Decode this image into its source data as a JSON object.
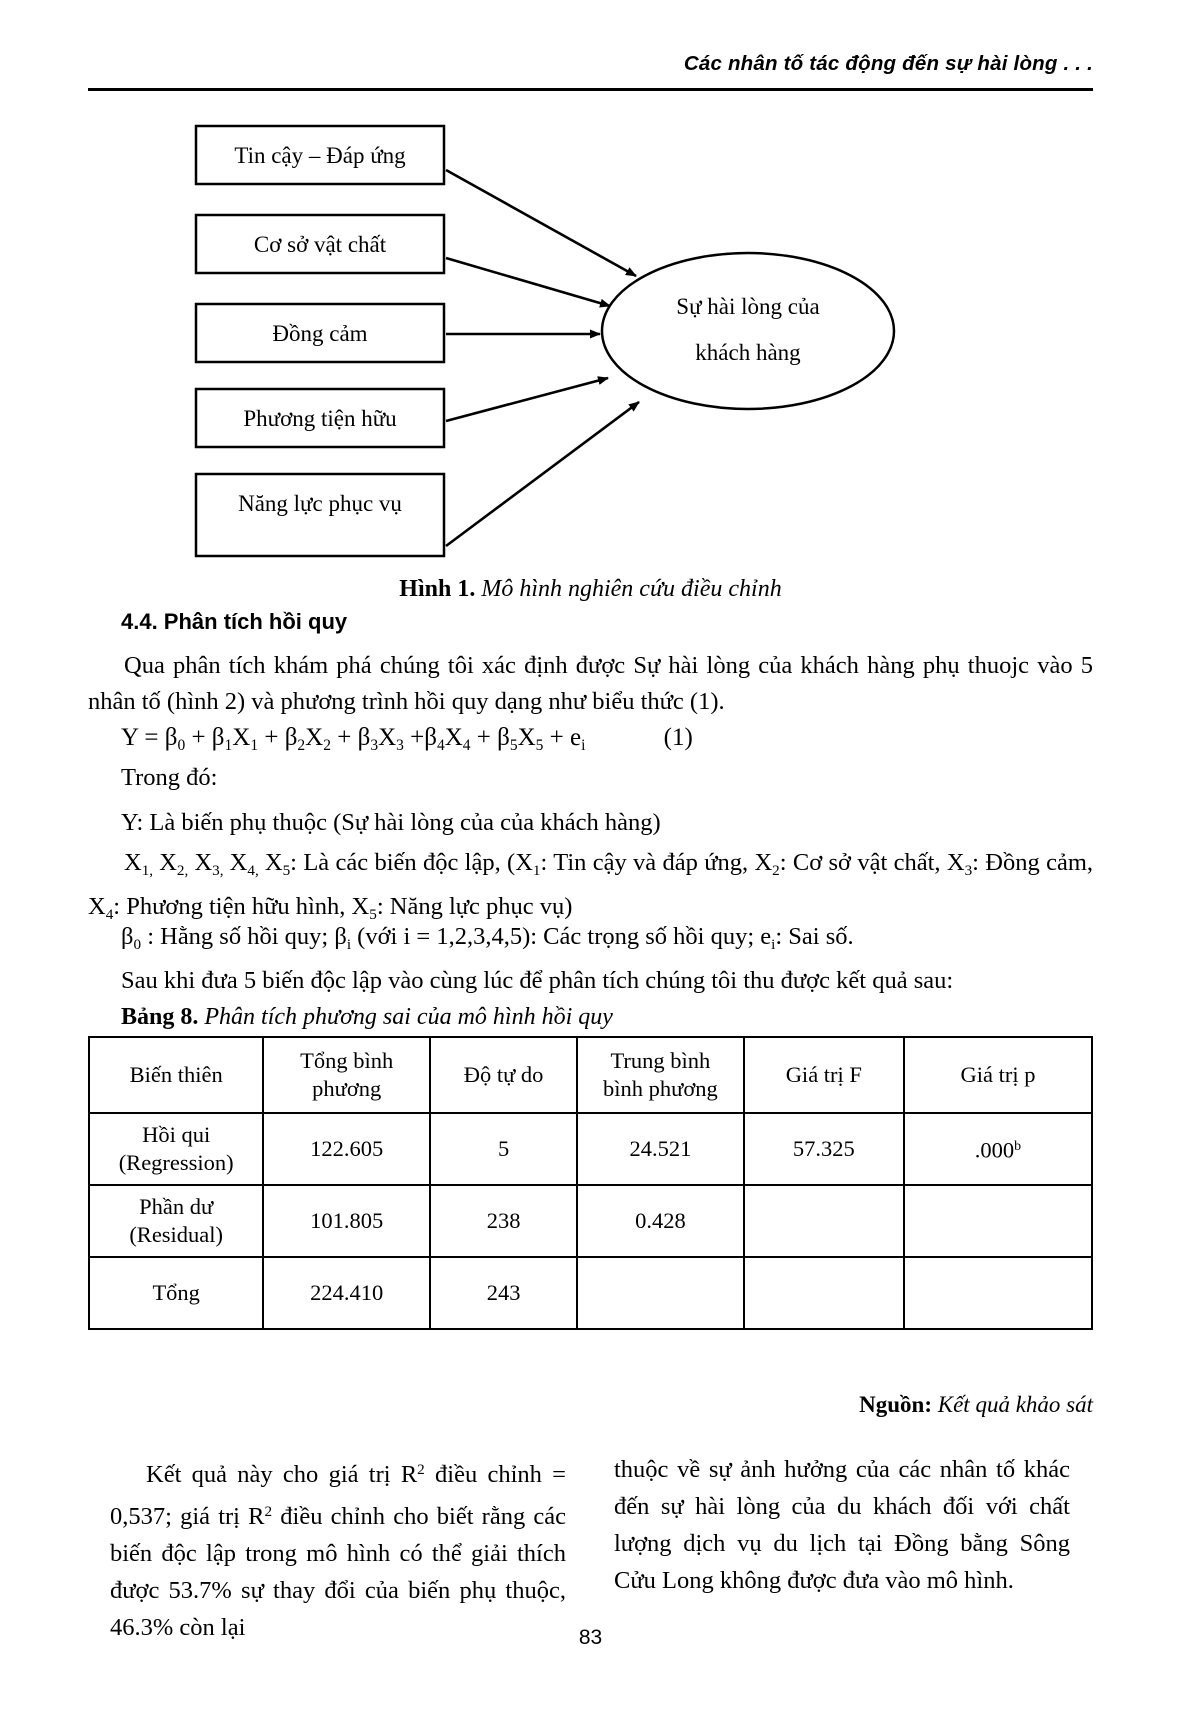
{
  "header": {
    "running_title": "Các nhân tố tác động đến sự hài lòng . . ."
  },
  "figure": {
    "boxes": [
      {
        "label": "Tin cậy – Đáp ứng"
      },
      {
        "label": "Cơ sở vật chất"
      },
      {
        "label": "Đồng cảm"
      },
      {
        "label": "Phương tiện hữu"
      },
      {
        "label": "Năng lực phục vụ"
      }
    ],
    "ellipse": {
      "line1": "Sự hài lòng của",
      "line2": "khách hàng"
    },
    "caption_label": "Hình 1.",
    "caption_text": "Mô hình nghiên cứu điều chỉnh"
  },
  "section": {
    "heading": "4.4. Phân tích hồi quy",
    "intro": "Qua phân tích khám phá chúng tôi xác định được Sự hài lòng của khách hàng phụ thuojc vào 5 nhân tố (hình 2) và phương trình hồi quy dạng như biểu thức (1).",
    "equation": {
      "lhs": "Y = β",
      "number": "(1)"
    },
    "trong_do": "Trong đó:",
    "y_def": "Y: Là biến phụ thuộc (Sự hài lòng của của khách hàng)",
    "x_def_tail": ": Là các biến độc lập, (X",
    "x_def_1": ": Tin cậy và đáp ứng, X",
    "x_def_2": ": Cơ sở vật chất, X",
    "x_def_3": ": Đồng cảm, X",
    "x_def_4": ": Phương tiện hữu hình, X",
    "x_def_5": ": Năng lực phục vụ)",
    "beta_def_a": " : Hằng số hồi quy; β",
    "beta_def_b": " (với i = 1,2,3,4,5): Các trọng số hồi quy; e",
    "beta_def_c": ": Sai số.",
    "sau_khi": "Sau khi đưa 5 biến độc lập vào cùng lúc để phân tích chúng tôi thu được kết quả sau:"
  },
  "table": {
    "title_label": "Bảng 8.",
    "title_text": "Phân tích phương sai của mô hình hồi quy",
    "columns": [
      "Biến thiên",
      "Tổng bình phương",
      "Độ tự do",
      "Trung bình bình phương",
      "Giá trị F",
      "Giá trị p"
    ],
    "rows": [
      {
        "name_line1": "Hồi qui",
        "name_line2": "(Regression)",
        "ss": "122.605",
        "df": "5",
        "ms": "24.521",
        "f": "57.325",
        "p": ".000",
        "p_sup": "b"
      },
      {
        "name_line1": "Phần dư",
        "name_line2": "(Residual)",
        "ss": "101.805",
        "df": "238",
        "ms": "0.428",
        "f": "",
        "p": "",
        "p_sup": ""
      },
      {
        "name_line1": "Tổng",
        "name_line2": "",
        "ss": "224.410",
        "df": "243",
        "ms": "",
        "f": "",
        "p": "",
        "p_sup": ""
      }
    ],
    "source_label": "Nguồn:",
    "source_text": "Kết quả khảo sát"
  },
  "body": {
    "col_left_a": "Kết quả này cho giá trị R",
    "col_left_sup": "2",
    "col_left_b": " điều chỉnh = 0,537; giá trị R",
    "col_left_c": " điều chỉnh cho biết rằng các biến độc lập trong mô hình có thể giải thích được 53.7% sự thay đổi của biến phụ thuộc, 46.3% còn lại",
    "col_right": "thuộc về sự ảnh hưởng của các nhân tố khác đến sự hài lòng của du khách đối với chất lượng dịch vụ du lịch tại Đồng bằng Sông Cửu Long không được đưa vào mô hình."
  },
  "footer": {
    "page_number": "83"
  }
}
